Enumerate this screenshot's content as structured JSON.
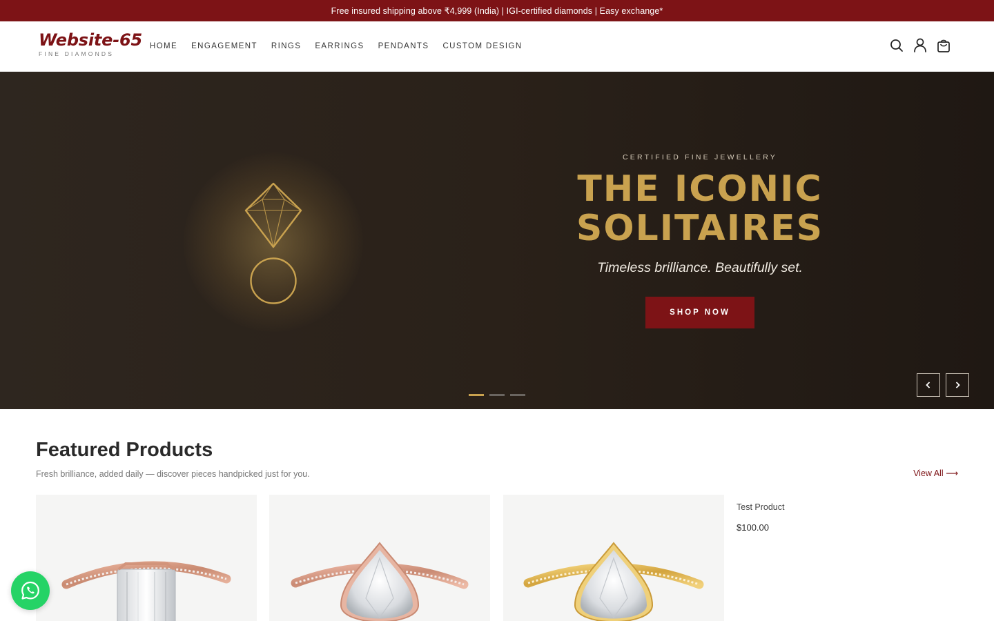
{
  "announcement": {
    "text": "Free insured shipping above ₹4,999 (India) | IGI-certified diamonds | Easy exchange*"
  },
  "header": {
    "logo_text": "Website-65",
    "logo_subtitle": "FINE DIAMONDS",
    "nav": [
      "HOME",
      "ENGAGEMENT",
      "RINGS",
      "EARRINGS",
      "PENDANTS",
      "CUSTOM DESIGN"
    ],
    "icons": [
      "search-icon",
      "user-icon",
      "cart-icon"
    ]
  },
  "hero": {
    "eyebrow": "CERTIFIED FINE JEWELLERY",
    "headline_line1": "THE ICONIC",
    "headline_line2": "SOLITAIRES",
    "tagline": "Timeless brilliance. Beautifully set.",
    "cta_label": "SHOP NOW",
    "slide_count": 3,
    "active_slide": 1
  },
  "featured": {
    "title": "Featured Products",
    "subtitle": "Fresh brilliance, added daily — discover pieces handpicked just for you.",
    "view_all_label": "View All ⟶",
    "product": {
      "name": "Test Product",
      "price": "$100.00"
    }
  },
  "colors": {
    "brand": "#7d1316",
    "gold": "#c9a24f",
    "hero_bg": "#2a2119",
    "whatsapp": "#25d366"
  }
}
